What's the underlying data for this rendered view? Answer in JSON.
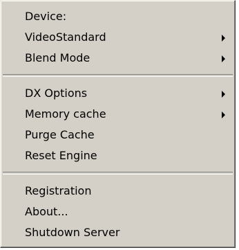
{
  "menu": {
    "groups": [
      [
        {
          "label": "Device:",
          "submenu": false
        },
        {
          "label": "VideoStandard",
          "submenu": true
        },
        {
          "label": "Blend Mode",
          "submenu": true
        }
      ],
      [
        {
          "label": "DX Options",
          "submenu": true
        },
        {
          "label": "Memory cache",
          "submenu": true
        },
        {
          "label": "Purge Cache",
          "submenu": false
        },
        {
          "label": "Reset Engine",
          "submenu": false
        }
      ],
      [
        {
          "label": "Registration",
          "submenu": false
        },
        {
          "label": "About...",
          "submenu": false
        },
        {
          "label": "Shutdown Server",
          "submenu": false
        }
      ]
    ],
    "colors": {
      "menu_bg": "#d4d0c8",
      "text": "#000000"
    }
  }
}
